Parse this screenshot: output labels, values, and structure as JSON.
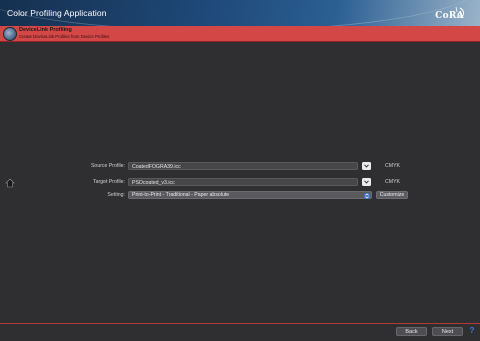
{
  "app": {
    "title": "Color Profiling Application",
    "logo_text": "CoRA"
  },
  "section": {
    "title": "DeviceLink Profiling",
    "subtitle": "Create DeviceLink Profiles from Device Profiles"
  },
  "form": {
    "source": {
      "label": "Source Profile:",
      "value": "CoatedFOGRA39.icc",
      "unit": "CMYK"
    },
    "target": {
      "label": "Target Profile:",
      "value": "PSOcoated_v3.icc",
      "unit": "CMYK"
    },
    "setting": {
      "label": "Setting:",
      "value": "Print-to-Print - Traditional - Paper absolute",
      "customize_label": "Customize"
    }
  },
  "footer": {
    "back_label": "Back",
    "next_label": "Next",
    "help_label": "?"
  },
  "colors": {
    "section_bar": "#d44747",
    "accent_blue": "#3f6fc8",
    "background": "#2f2f31"
  },
  "icons": {
    "header_badge": "profile-globe-icon",
    "side": "home-arrow-icon",
    "dropdown": "chevron-down-icon",
    "help": "help-icon"
  }
}
